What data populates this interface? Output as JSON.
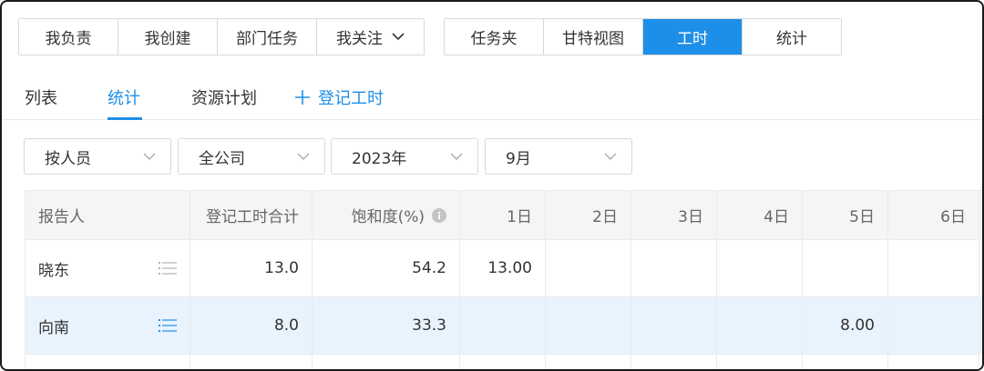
{
  "top_groups": {
    "group1": [
      "我负责",
      "我创建",
      "部门任务",
      "我关注"
    ],
    "group2": [
      "任务夹",
      "甘特视图",
      "工时",
      "统计"
    ],
    "active": "工时"
  },
  "subtabs": {
    "items": [
      "列表",
      "统计",
      "资源计划"
    ],
    "active": "统计",
    "register_label": "登记工时"
  },
  "filters": {
    "group_by": "按人员",
    "scope": "全公司",
    "year": "2023年",
    "month": "9月"
  },
  "table": {
    "headers": [
      "报告人",
      "登记工时合计",
      "饱和度(%)",
      "1日",
      "2日",
      "3日",
      "4日",
      "5日",
      "6日"
    ],
    "rows": [
      {
        "name": "晓东",
        "total": "13.0",
        "saturation": "54.2",
        "days": [
          "13.00",
          "",
          "",
          "",
          "",
          ""
        ]
      },
      {
        "name": "向南",
        "total": "8.0",
        "saturation": "33.3",
        "days": [
          "",
          "",
          "",
          "",
          "8.00",
          ""
        ]
      }
    ]
  },
  "colors": {
    "accent": "#1e8fe8",
    "selected_row": "#e9f3fd",
    "header_bg": "#f4f5f7"
  },
  "icons": {
    "dropdown": "chevron-down-icon",
    "add": "plus-icon",
    "info": "info-icon",
    "row_action": "list-icon"
  }
}
